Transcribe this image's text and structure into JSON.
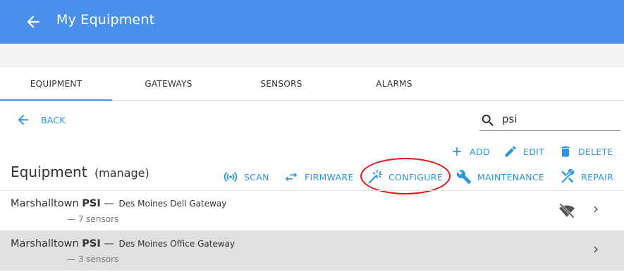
{
  "header": {
    "title": "My Equipment",
    "back_icon": "arrow-back-icon",
    "color": "#4a8fea"
  },
  "tabs": [
    {
      "label": "EQUIPMENT",
      "active": true
    },
    {
      "label": "GATEWAYS",
      "active": false
    },
    {
      "label": "SENSORS",
      "active": false
    },
    {
      "label": "ALARMS",
      "active": false
    }
  ],
  "back_link": {
    "label": "BACK"
  },
  "search": {
    "value": "psi",
    "icon": "search-icon"
  },
  "actions_top": [
    {
      "label": "ADD",
      "icon": "plus-icon"
    },
    {
      "label": "EDIT",
      "icon": "pencil-icon"
    },
    {
      "label": "DELETE",
      "icon": "trash-icon"
    }
  ],
  "actions": [
    {
      "label": "SCAN",
      "icon": "scan-signal-icon"
    },
    {
      "label": "FIRMWARE",
      "icon": "swap-arrows-icon"
    },
    {
      "label": "CONFIGURE",
      "icon": "magic-wand-icon"
    },
    {
      "label": "MAINTENANCE",
      "icon": "wrench-icon"
    },
    {
      "label": "REPAIR",
      "icon": "tools-icon"
    }
  ],
  "section": {
    "title": "Equipment",
    "subtitle": "(manage)"
  },
  "list": [
    {
      "name": "Marshalltown",
      "match": "PSI",
      "dash": "—",
      "gateway": "Des Moines Dell Gateway",
      "sensors": "— 7 sensors",
      "offline": true,
      "selected": false
    },
    {
      "name": "Marshalltown",
      "match": "PSI",
      "dash": "—",
      "gateway": "Des Moines Office Gateway",
      "sensors": "— 3 sensors",
      "offline": false,
      "selected": true
    }
  ],
  "colors": {
    "accent": "#2d97e0",
    "highlight": "#e01818"
  }
}
